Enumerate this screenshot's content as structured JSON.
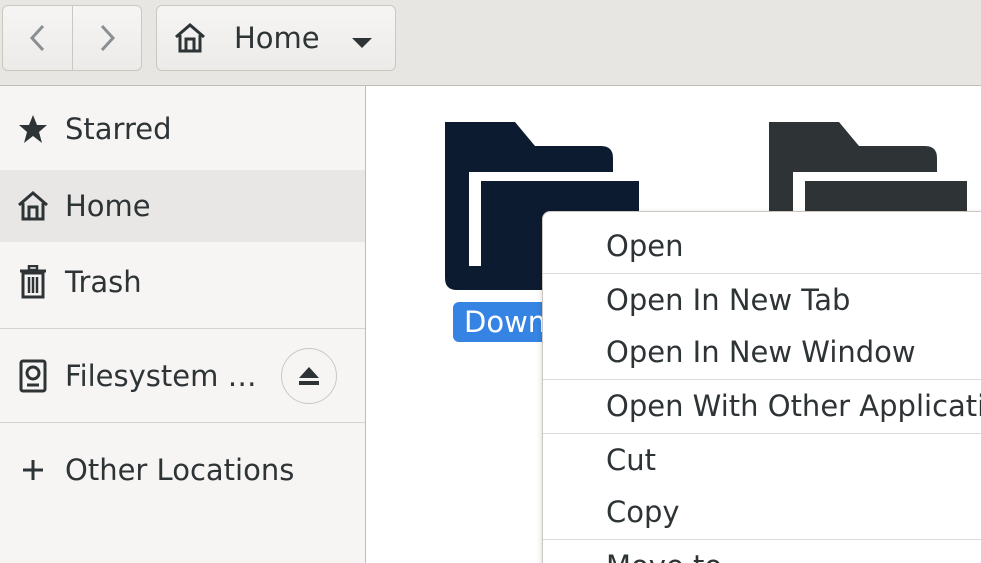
{
  "header": {
    "back_icon": "chevron-left-icon",
    "forward_icon": "chevron-right-icon",
    "path": {
      "icon": "home-icon",
      "label": "Home",
      "dropdown_icon": "triangle-down-icon"
    }
  },
  "sidebar": {
    "items": [
      {
        "label": "Starred",
        "icon": "star-icon",
        "selected": false
      },
      {
        "label": "Home",
        "icon": "home-icon",
        "selected": true
      },
      {
        "label": "Trash",
        "icon": "trash-icon",
        "selected": false
      },
      {
        "label": "Filesystem …",
        "icon": "drive-icon",
        "eject_icon": "eject-icon"
      },
      {
        "label": "Other Locations",
        "icon": "plus-icon"
      }
    ]
  },
  "main": {
    "folders": [
      {
        "label": "Downloads",
        "selected": true,
        "icon": "folder-icon",
        "color": "#0d1b30"
      },
      {
        "icon": "folder-icon",
        "color": "#2e3436"
      }
    ]
  },
  "context_menu": {
    "items": [
      {
        "label": "Open"
      },
      {
        "label": "Open In New Tab"
      },
      {
        "label": "Open In New Window"
      },
      {
        "label": "Open With Other Application"
      },
      {
        "label": "Cut"
      },
      {
        "label": "Copy"
      },
      {
        "label": "Move to…"
      }
    ]
  },
  "colors": {
    "accent": "#3584e4",
    "sidebar_bg": "#f6f5f4",
    "headerbar_bg": "#e8e6e3"
  }
}
